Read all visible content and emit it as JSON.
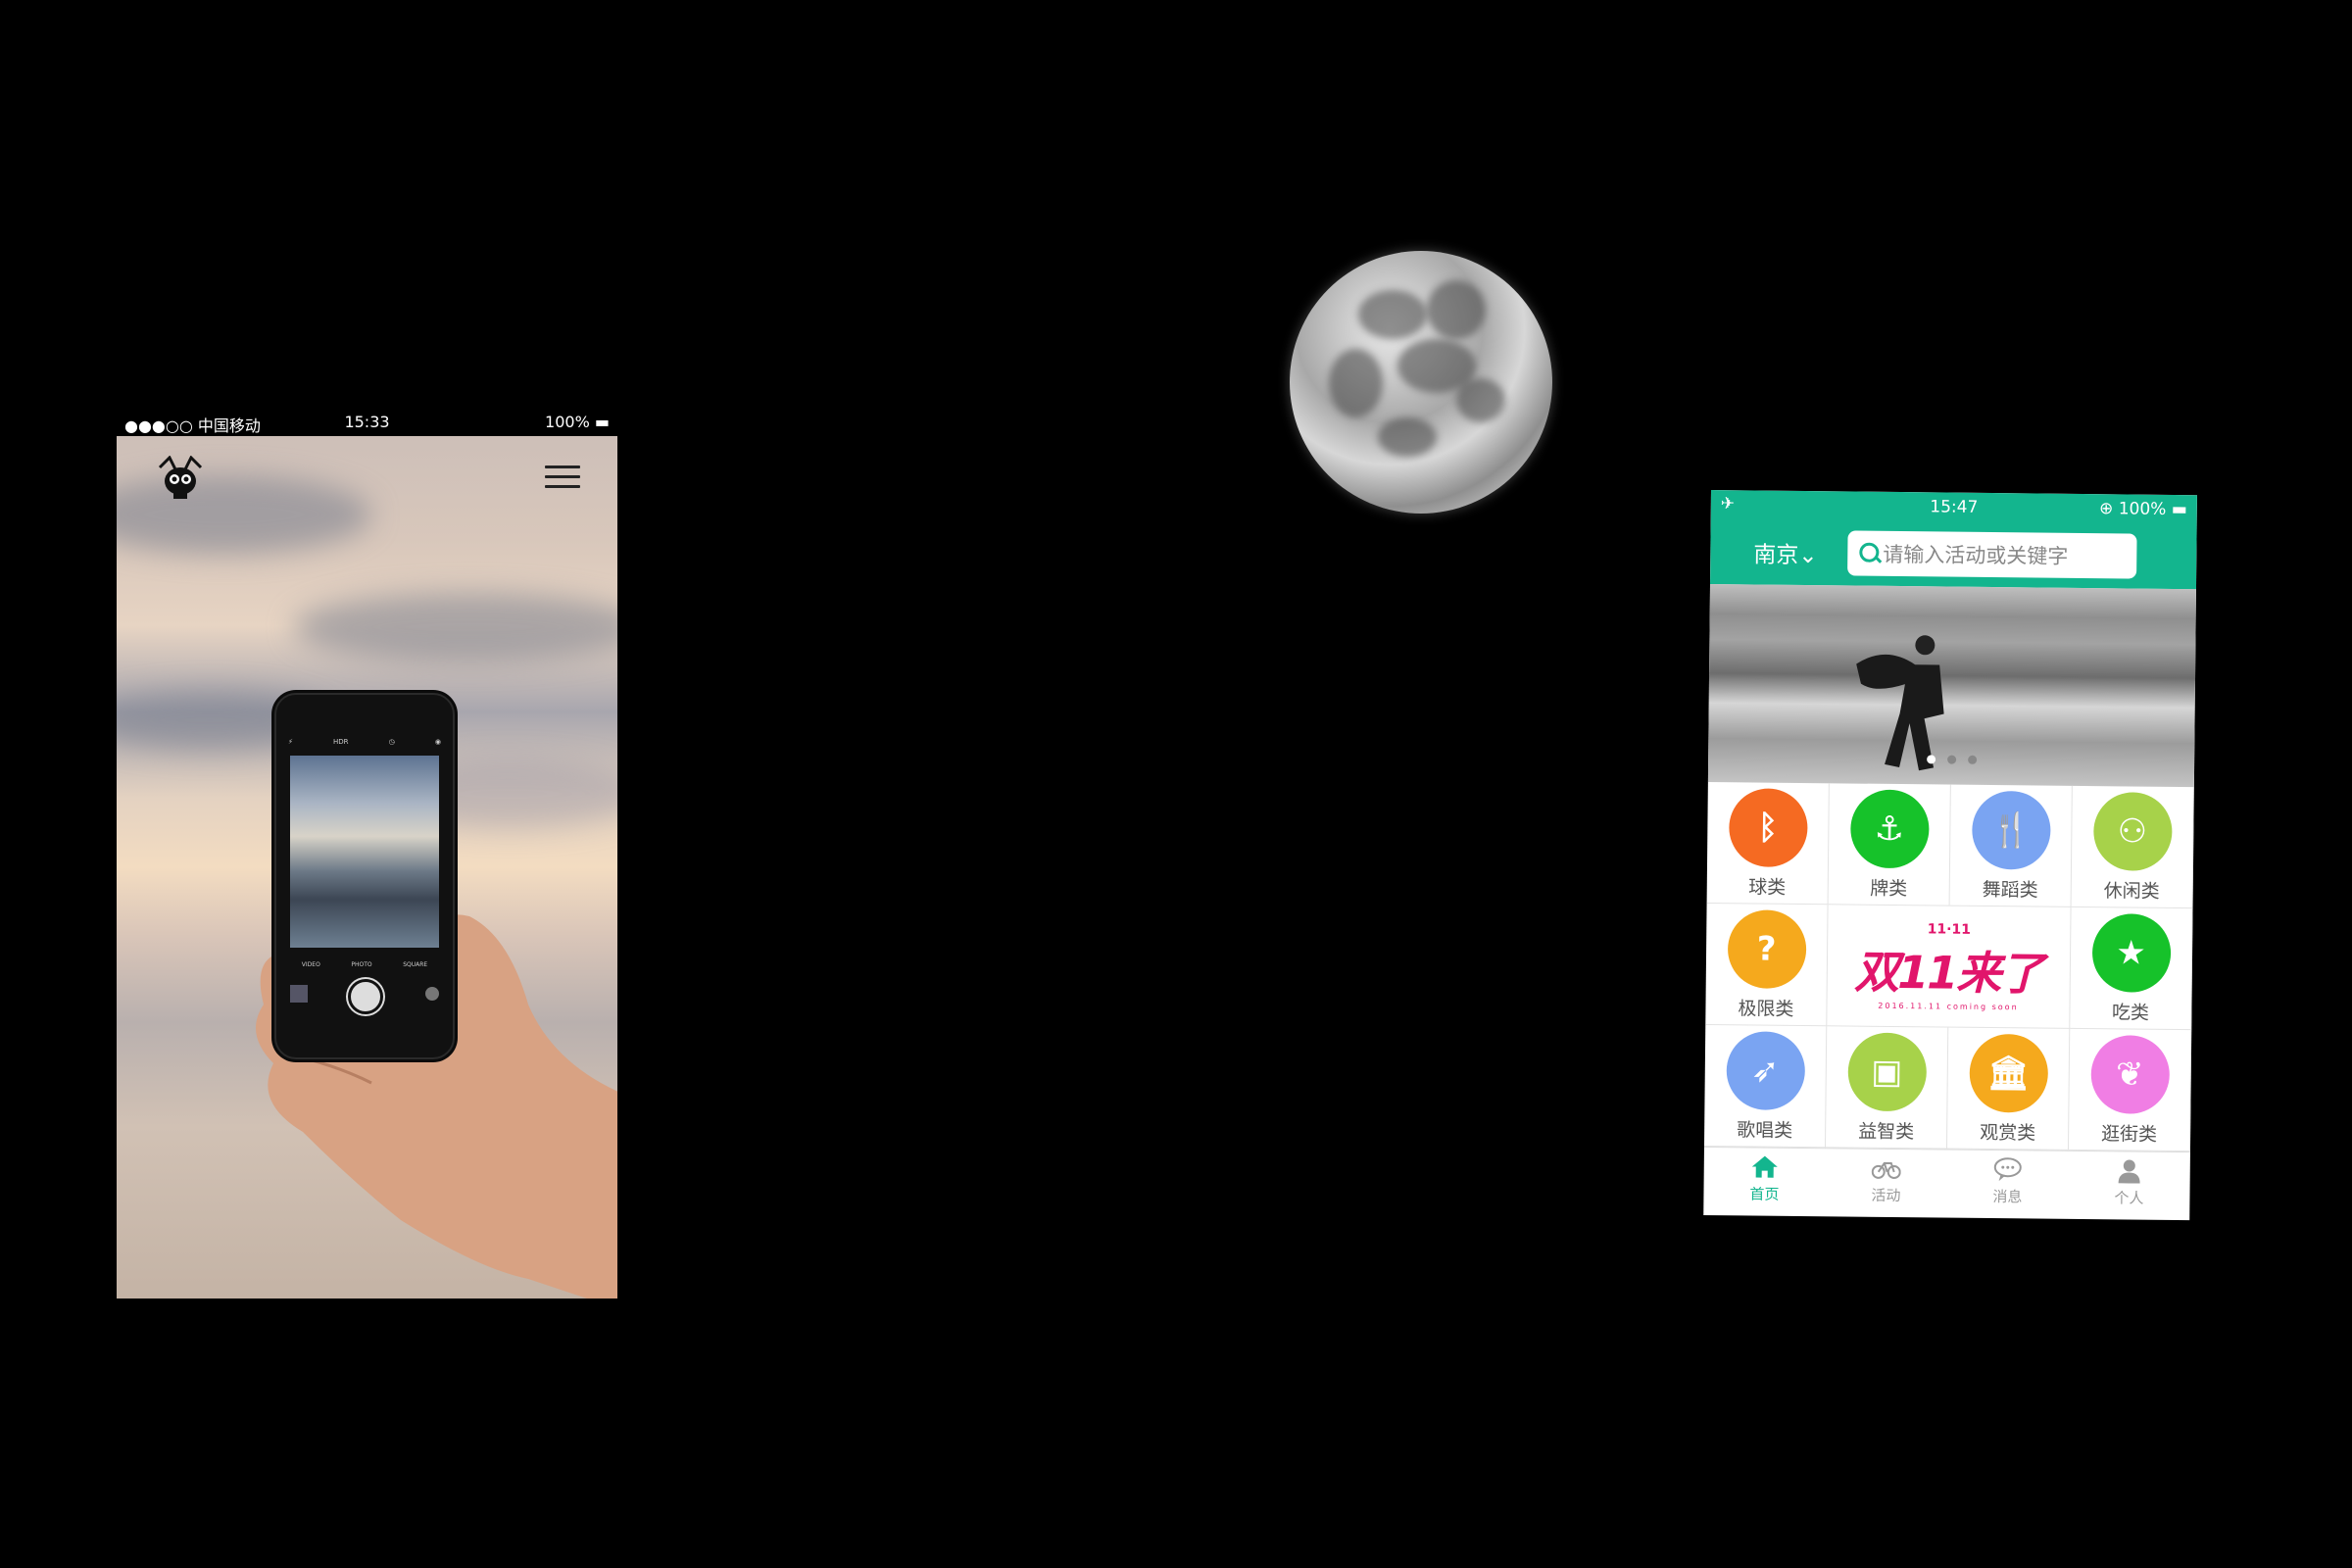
{
  "left_phone": {
    "status": {
      "carrier": "●●●○○ 中国移动",
      "time": "15:33",
      "battery": "100%"
    }
  },
  "right_phone": {
    "status": {
      "time": "15:47",
      "battery": "100%"
    },
    "city": "南京",
    "search_placeholder": "请输入活动或关键字",
    "categories": [
      {
        "label": "球类",
        "color": "#f56a22",
        "icon": "bluetooth-icon"
      },
      {
        "label": "牌类",
        "color": "#16c22a",
        "icon": "anchor-icon"
      },
      {
        "label": "舞蹈类",
        "color": "#7aa4f2",
        "icon": "cutlery-icon"
      },
      {
        "label": "休闲类",
        "color": "#a7d24a",
        "icon": "group-icon"
      },
      {
        "label": "极限类",
        "color": "#f5a91d",
        "icon": "question-icon"
      },
      {
        "label": "吃类",
        "color": "#16c22a",
        "icon": "star-icon"
      },
      {
        "label": "歌唱类",
        "color": "#7aa4f2",
        "icon": "rocket-icon"
      },
      {
        "label": "益智类",
        "color": "#a7d24a",
        "icon": "briefcase-icon"
      },
      {
        "label": "观赏类",
        "color": "#f5a91d",
        "icon": "museum-icon"
      },
      {
        "label": "逛街类",
        "color": "#f07ee4",
        "icon": "leaf-icon"
      }
    ],
    "promo": {
      "tag": "11·11",
      "title": "双11来了",
      "subtitle": "2016.11.11 coming soon"
    },
    "tabs": [
      {
        "label": "首页",
        "icon": "home-icon",
        "active": true
      },
      {
        "label": "活动",
        "icon": "bicycle-icon",
        "active": false
      },
      {
        "label": "消息",
        "icon": "chat-icon",
        "active": false
      },
      {
        "label": "个人",
        "icon": "user-icon",
        "active": false
      }
    ],
    "accent_color": "#13b58e"
  }
}
